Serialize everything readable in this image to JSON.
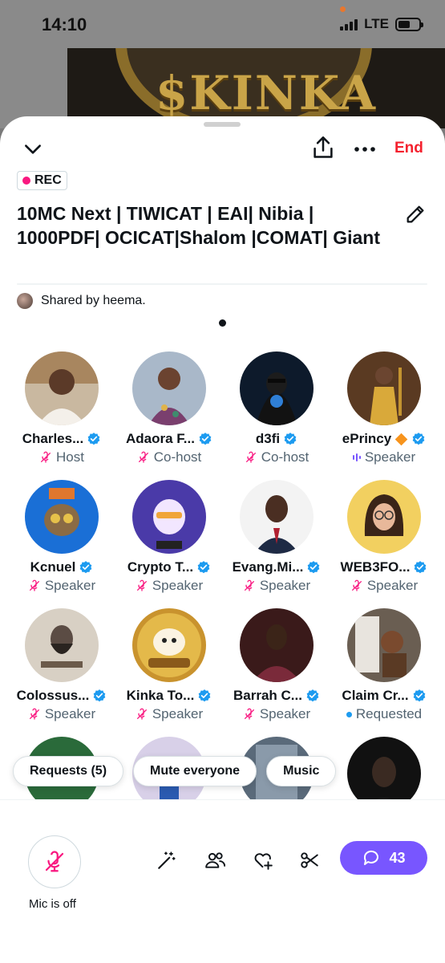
{
  "status_bar": {
    "time": "14:10",
    "network": "LTE",
    "battery_level": 0.6
  },
  "background_banner": {
    "text": "$KINKA"
  },
  "header": {
    "end_label": "End"
  },
  "rec_badge": {
    "label": "REC"
  },
  "space": {
    "title": "10MC Next | TIWICAT | EAI| Nibia | 1000PDF| OCICAT|Shalom |COMAT| Giant",
    "shared_by": "Shared by heema."
  },
  "participants": [
    {
      "name": "Charles...",
      "role": "Host",
      "verified": true,
      "role_icon": "mic-off"
    },
    {
      "name": "Adaora F...",
      "role": "Co-host",
      "verified": true,
      "role_icon": "mic-off"
    },
    {
      "name": "d3fi",
      "role": "Co-host",
      "verified": true,
      "role_icon": "mic-off"
    },
    {
      "name": "ePrincy",
      "role": "Speaker",
      "verified": true,
      "role_icon": "speaking-bars",
      "emoji": "orange-diamond"
    },
    {
      "name": "Kcnuel",
      "role": "Speaker",
      "verified": true,
      "role_icon": "mic-off"
    },
    {
      "name": "Crypto T...",
      "role": "Speaker",
      "verified": true,
      "role_icon": "mic-off"
    },
    {
      "name": "Evang.Mi...",
      "role": "Speaker",
      "verified": true,
      "role_icon": "mic-off"
    },
    {
      "name": "WEB3FO...",
      "role": "Speaker",
      "verified": true,
      "role_icon": "mic-off"
    },
    {
      "name": "Colossus...",
      "role": "Speaker",
      "verified": true,
      "role_icon": "mic-off"
    },
    {
      "name": "Kinka To...",
      "role": "Speaker",
      "verified": true,
      "role_icon": "mic-off"
    },
    {
      "name": "Barrah C...",
      "role": "Speaker",
      "verified": true,
      "role_icon": "mic-off"
    },
    {
      "name": "Claim Cr...",
      "role": "Requested",
      "verified": true,
      "role_icon": "requested-dot"
    }
  ],
  "actions": {
    "requests_label": "Requests (5)",
    "mute_label": "Mute everyone",
    "music_label": "Music"
  },
  "bottom": {
    "mic_label": "Mic is off",
    "comment_count": "43"
  },
  "colors": {
    "end_red": "#f4212e",
    "rec_pink": "#f91880",
    "verified_blue": "#1d9bf0",
    "accent_purple": "#7856ff",
    "muted_pink": "#f91880"
  }
}
